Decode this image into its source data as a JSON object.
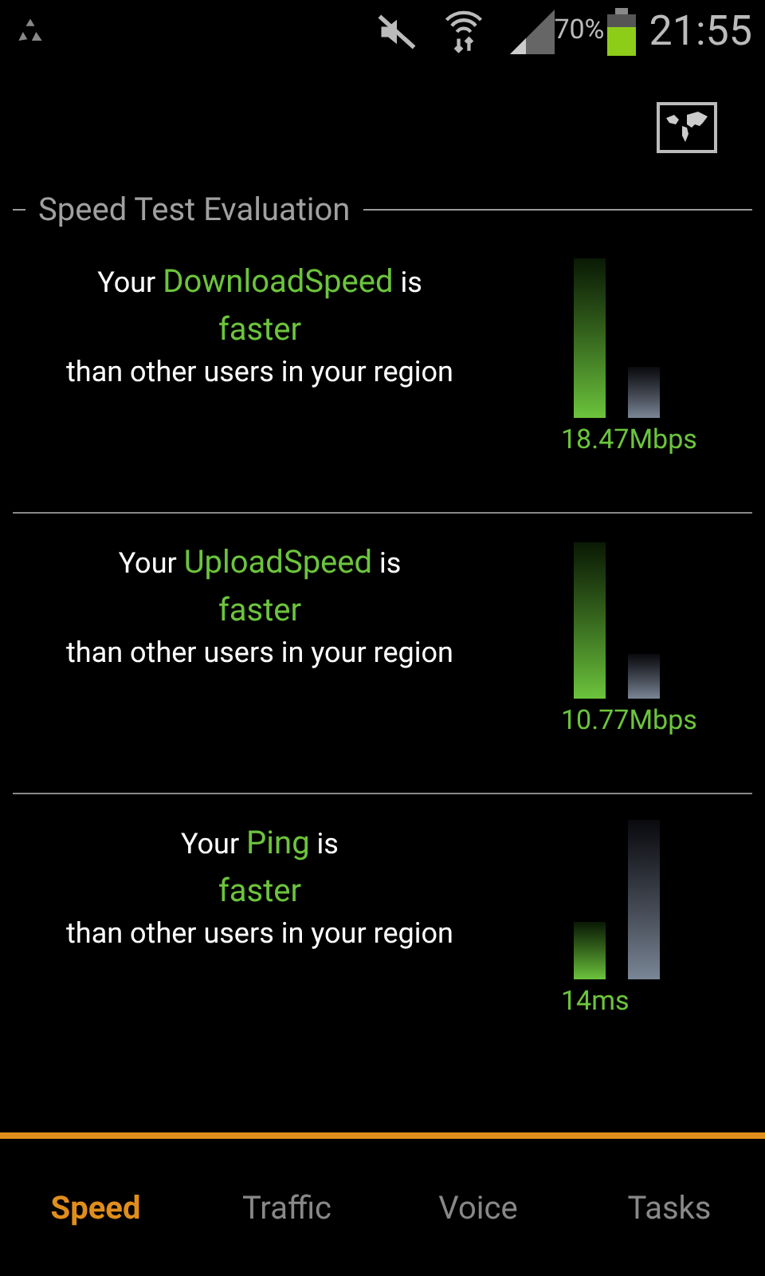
{
  "status_bar": {
    "battery": "70%",
    "time": "21:55"
  },
  "section_title": "Speed Test Evaluation",
  "results": [
    {
      "prefix": "Your",
      "metric": "DownloadSpeed",
      "suffix": "is",
      "verdict": "faster",
      "comparison": "than other users in your region",
      "reading": "18.47Mbps",
      "bars": [
        {
          "kind": "user"
        },
        {
          "kind": "region"
        }
      ]
    },
    {
      "prefix": "Your",
      "metric": "UploadSpeed",
      "suffix": "is",
      "verdict": "faster",
      "comparison": "than other users in your region",
      "reading": "10.77Mbps",
      "bars": [
        {
          "kind": "user"
        },
        {
          "kind": "region"
        }
      ]
    },
    {
      "prefix": "Your",
      "metric": "Ping",
      "suffix": "is",
      "verdict": "faster",
      "comparison": "than other users in your region",
      "reading": "14ms",
      "bars": [
        {
          "kind": "user"
        },
        {
          "kind": "region"
        }
      ]
    }
  ],
  "tabs": [
    {
      "label": "Speed",
      "selected": true
    },
    {
      "label": "Traffic",
      "selected": false
    },
    {
      "label": "Voice",
      "selected": false
    },
    {
      "label": "Tasks",
      "selected": false
    }
  ]
}
